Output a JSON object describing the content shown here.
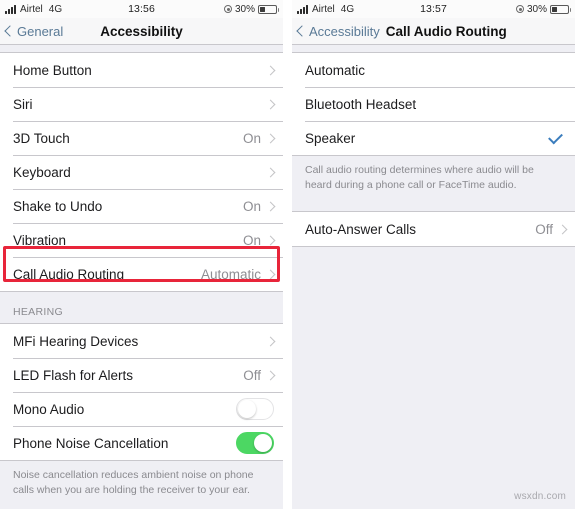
{
  "left": {
    "status_bar": {
      "carrier": "Airtel",
      "network": "4G",
      "time": "13:56",
      "battery_percent": "30%",
      "signal_icon": "signal-bars-icon",
      "location_icon": "location-services-icon",
      "battery_icon": "battery-icon"
    },
    "nav": {
      "back_label": "General",
      "title": "Accessibility",
      "back_icon": "chevron-left-icon"
    },
    "group1": [
      {
        "label": "Home Button",
        "value": "",
        "accessory": "chevron"
      },
      {
        "label": "Siri",
        "value": "",
        "accessory": "chevron"
      },
      {
        "label": "3D Touch",
        "value": "On",
        "accessory": "chevron"
      },
      {
        "label": "Keyboard",
        "value": "",
        "accessory": "chevron"
      },
      {
        "label": "Shake to Undo",
        "value": "On",
        "accessory": "chevron"
      },
      {
        "label": "Vibration",
        "value": "On",
        "accessory": "chevron"
      },
      {
        "label": "Call Audio Routing",
        "value": "Automatic",
        "accessory": "chevron"
      }
    ],
    "section_header": "HEARING",
    "group2": [
      {
        "label": "MFi Hearing Devices",
        "value": "",
        "accessory": "chevron"
      },
      {
        "label": "LED Flash for Alerts",
        "value": "Off",
        "accessory": "chevron"
      },
      {
        "label": "Mono Audio",
        "value": "",
        "accessory": "toggle-off"
      },
      {
        "label": "Phone Noise Cancellation",
        "value": "",
        "accessory": "toggle-on"
      }
    ],
    "footer": "Noise cancellation reduces ambient noise on phone calls when you are holding the receiver to your ear.",
    "highlight_color": "#e8253a"
  },
  "right": {
    "status_bar": {
      "carrier": "Airtel",
      "network": "4G",
      "time": "13:57",
      "battery_percent": "30%",
      "signal_icon": "signal-bars-icon",
      "location_icon": "location-services-icon",
      "battery_icon": "battery-icon"
    },
    "nav": {
      "back_label": "Accessibility",
      "title": "Call Audio Routing",
      "back_icon": "chevron-left-icon"
    },
    "group1": [
      {
        "label": "Automatic",
        "value": "",
        "accessory": "none"
      },
      {
        "label": "Bluetooth Headset",
        "value": "",
        "accessory": "none"
      },
      {
        "label": "Speaker",
        "value": "",
        "accessory": "checkmark"
      }
    ],
    "footer": "Call audio routing determines where audio will be heard during a phone call or FaceTime audio.",
    "group2": [
      {
        "label": "Auto-Answer Calls",
        "value": "Off",
        "accessory": "chevron"
      }
    ],
    "accent_color": "#3b7dbd"
  },
  "watermark": "wsxdn.com"
}
